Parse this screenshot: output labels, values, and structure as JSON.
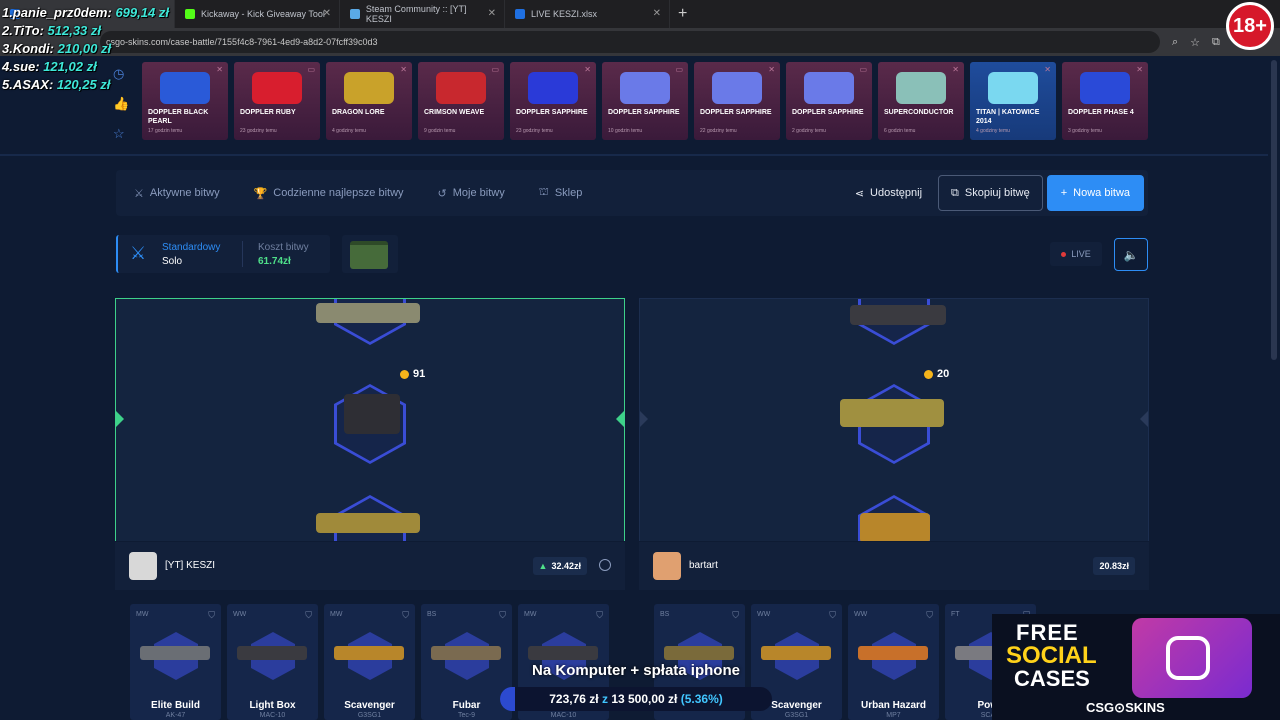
{
  "browser": {
    "tabs": [
      {
        "label": "",
        "color": "#1f6fe0"
      },
      {
        "label": "Kickaway - Kick Giveaway Tool",
        "color": "#53fc18"
      },
      {
        "label": "Steam Community :: [YT] KESZI",
        "color": "#5aa9e6"
      },
      {
        "label": "LIVE KESZI.xlsx",
        "color": "#1f6fe0"
      }
    ],
    "url": "csgo-skins.com/case-battle/7155f4c8-7961-4ed9-a8d2-07fcff39c0d3"
  },
  "leaderboard": [
    {
      "rank": "1.",
      "name": "panie_prz0dem",
      "amount": "699,14 zł"
    },
    {
      "rank": "2.",
      "name": "TiTo",
      "amount": "512,33 zł"
    },
    {
      "rank": "3.",
      "name": "Kondi",
      "amount": "210,00 zł"
    },
    {
      "rank": "4.",
      "name": "sue",
      "amount": "121,02 zł"
    },
    {
      "rank": "5.",
      "name": "ASAX",
      "amount": "120,25 zł"
    }
  ],
  "age_badge": "18+",
  "live_drops": [
    {
      "name": "DOPPLER BLACK PEARL",
      "time": "17 godzin temu",
      "img": "#2a5ad8",
      "style": "red"
    },
    {
      "name": "DOPPLER RUBY",
      "time": "23 godziny temu",
      "img": "#d81e2e",
      "style": "red"
    },
    {
      "name": "DRAGON LORE",
      "time": "4 godziny temu",
      "img": "#c9a22a",
      "style": "red"
    },
    {
      "name": "CRIMSON WEAVE",
      "time": "9 godzin temu",
      "img": "#c8282e",
      "style": "red"
    },
    {
      "name": "DOPPLER SAPPHIRE",
      "time": "23 godziny temu",
      "img": "#2a3ad8",
      "style": "red"
    },
    {
      "name": "DOPPLER SAPPHIRE",
      "time": "10 godzin temu",
      "img": "#6a7ae8",
      "style": "red"
    },
    {
      "name": "DOPPLER SAPPHIRE",
      "time": "22 godziny temu",
      "img": "#6a7ae8",
      "style": "red"
    },
    {
      "name": "DOPPLER SAPPHIRE",
      "time": "2 godziny temu",
      "img": "#6a7ae8",
      "style": "red"
    },
    {
      "name": "SUPERCONDUCTOR",
      "time": "6 godzin temu",
      "img": "#8ac0b8",
      "style": "red"
    },
    {
      "name": "TITAN | KATOWICE 2014",
      "time": "4 godziny temu",
      "img": "#7ad8f0",
      "style": "blue"
    },
    {
      "name": "DOPPLER PHASE 4",
      "time": "3 godziny temu",
      "img": "#2a4ad8",
      "style": "red"
    }
  ],
  "nav": {
    "active": "Aktywne bitwy",
    "daily": "Codzienne najlepsze bitwy",
    "mine": "Moje bitwy",
    "shop": "Sklep",
    "share": "Udostępnij",
    "copy": "Skopiuj bitwę",
    "new": "Nowa bitwa"
  },
  "battle": {
    "mode_label": "Standardowy",
    "mode_value": "Solo",
    "cost_label": "Koszt bitwy",
    "cost_value": "61.74zł",
    "live": "LIVE"
  },
  "players": [
    {
      "name": "[YT] KESZI",
      "value": "32.42zł",
      "coin": "91",
      "avatar": "#d8d8d8"
    },
    {
      "name": "bartart",
      "value": "20.83zł",
      "coin": "20",
      "avatar": "#e0a070"
    }
  ],
  "left_items": [
    {
      "q": "MW",
      "name": "Elite Build",
      "sub": "AK-47",
      "color": "#6a6e74"
    },
    {
      "q": "WW",
      "name": "Light Box",
      "sub": "MAC-10",
      "color": "#3a3a40"
    },
    {
      "q": "MW",
      "name": "Scavenger",
      "sub": "G3SG1",
      "color": "#b8862a"
    },
    {
      "q": "BS",
      "name": "Fubar",
      "sub": "Tec-9",
      "color": "#7a6a50"
    },
    {
      "q": "MW",
      "name": "Light Box",
      "sub": "MAC-10",
      "color": "#3a3a40"
    }
  ],
  "right_items": [
    {
      "q": "BS",
      "name": "",
      "sub": "",
      "color": "#7a6a3a"
    },
    {
      "q": "WW",
      "name": "Scavenger",
      "sub": "G3SG1",
      "color": "#b8862a"
    },
    {
      "q": "WW",
      "name": "Urban Hazard",
      "sub": "MP7",
      "color": "#c8702a"
    },
    {
      "q": "FT",
      "name": "Powe",
      "sub": "SCAR",
      "color": "#7a7a80"
    }
  ],
  "donation": {
    "title": "Na Komputer + spłata iphone",
    "current": "723,76 zł",
    "sep": "z",
    "goal": "13 500,00 zł",
    "percent": "(5.36%)",
    "progress": 0.0536
  },
  "ad": {
    "l1": "FREE",
    "l2": "SOCIAL",
    "l3": "CASES",
    "brand": "CSG⊙SKINS"
  }
}
